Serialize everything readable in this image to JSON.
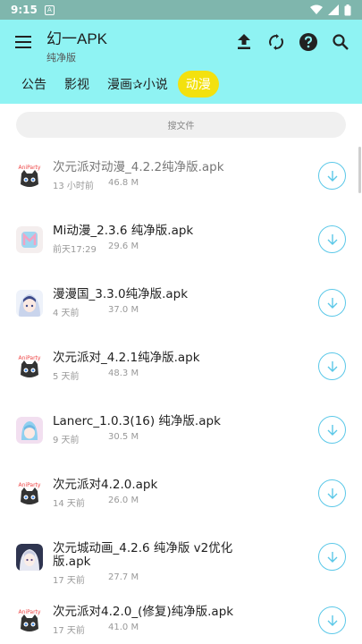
{
  "status": {
    "time": "9:15",
    "left_icon": "A"
  },
  "app_bar": {
    "title": "幻一APK",
    "subtitle": "纯净版"
  },
  "tabs": [
    {
      "label": "公告",
      "active": false
    },
    {
      "label": "影视",
      "active": false
    },
    {
      "label": "漫画✰小说",
      "active": false
    },
    {
      "label": "动漫",
      "active": true
    }
  ],
  "search": {
    "placeholder": "搜文件"
  },
  "files": [
    {
      "name": "次元派对动漫_4.2.2纯净版.apk",
      "time": "13 小时前",
      "size": "46.8 M",
      "icon": "anime-party-cat-icon"
    },
    {
      "name": "Mi动漫_2.3.6 纯净版.apk",
      "time": "前天17:29",
      "size": "29.6 M",
      "icon": "mi-anime-icon"
    },
    {
      "name": "漫漫国_3.3.0纯净版.apk",
      "time": "4 天前",
      "size": "37.0 M",
      "icon": "anime-girl-icon"
    },
    {
      "name": "次元派对_4.2.1纯净版.apk",
      "time": "5 天前",
      "size": "48.3 M",
      "icon": "anime-party-cat-icon"
    },
    {
      "name": "Lanerc_1.0.3(16) 纯净版.apk",
      "time": "9 天前",
      "size": "30.5 M",
      "icon": "lanerc-icon"
    },
    {
      "name": "次元派对4.2.0.apk",
      "time": "14 天前",
      "size": "26.0 M",
      "icon": "anime-party-cat-icon"
    },
    {
      "name": "次元城动画_4.2.6 纯净版 v2优化版.apk",
      "time": "17 天前",
      "size": "27.7 M",
      "icon": "anime-city-icon"
    },
    {
      "name": "次元派对4.2.0_(修复)纯净版.apk",
      "time": "17 天前",
      "size": "41.0 M",
      "icon": "anime-party-cat-icon"
    }
  ],
  "colors": {
    "app_bar": "#8ff3f3",
    "active_tab": "#f3e10e",
    "status_bar": "#7fb6ad",
    "download_accent": "#5bc8e8"
  }
}
